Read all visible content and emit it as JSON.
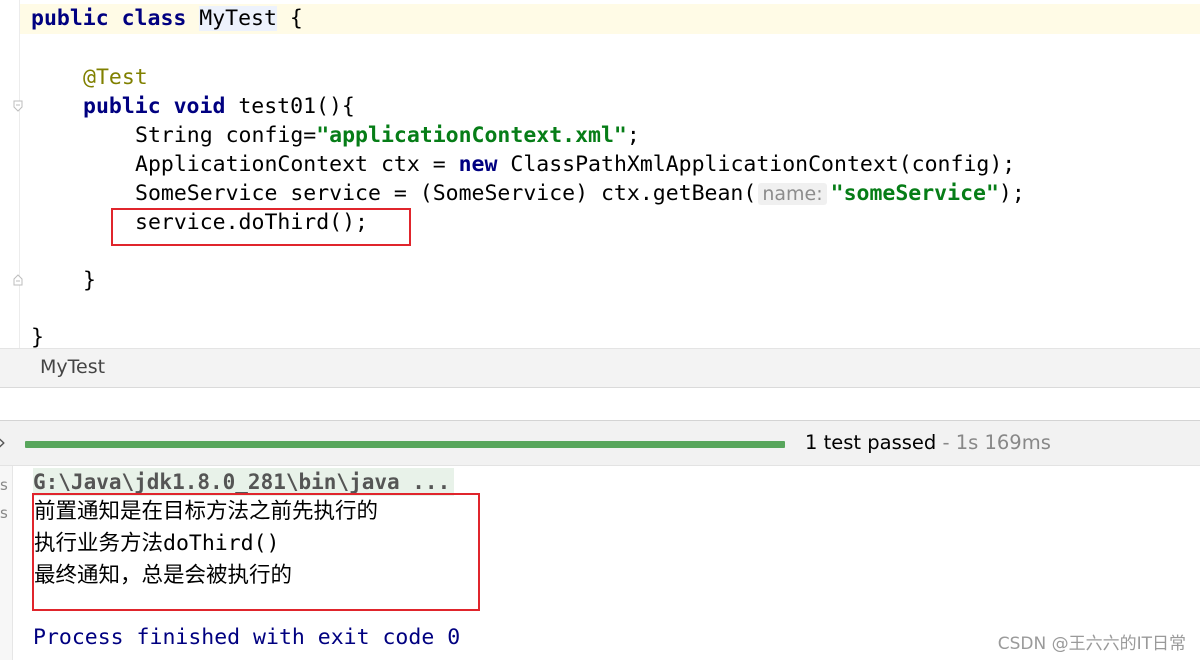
{
  "editor": {
    "lines": {
      "class_kw": "public class ",
      "class_name": "MyTest",
      "class_open": " {",
      "annotation": "@Test",
      "method_kw": "public void ",
      "method_sig": "test01(){",
      "l1_pre": "String config=",
      "l1_str": "\"applicationContext.xml\"",
      "l1_post": ";",
      "l2_pre": "ApplicationContext ctx = ",
      "l2_kw": "new",
      "l2_post": " ClassPathXmlApplicationContext(config);",
      "l3_pre": "SomeService service = (SomeService) ctx.getBean(",
      "l3_hint": "name:",
      "l3_str": "\"someService\"",
      "l3_post": ");",
      "l4": "service.doThird();",
      "method_close": "}",
      "class_close": "}"
    }
  },
  "tab": {
    "label": "MyTest"
  },
  "run": {
    "status": "1 test passed",
    "duration": " - 1s 169ms",
    "progress": 1.0,
    "progress_color": "#58a65c"
  },
  "console": {
    "command": "G:\\Java\\jdk1.8.0_281\\bin\\java ...",
    "output": [
      "前置通知是在目标方法之前先执行的",
      "执行业务方法doThird()",
      "最终通知，总是会被执行的"
    ],
    "exit": "Process finished with exit code 0"
  },
  "watermark": "CSDN @王六六的IT日常",
  "colors": {
    "highlight_box": "#e0252c",
    "keyword": "#000080",
    "string": "#067d17",
    "annotation": "#808000"
  }
}
